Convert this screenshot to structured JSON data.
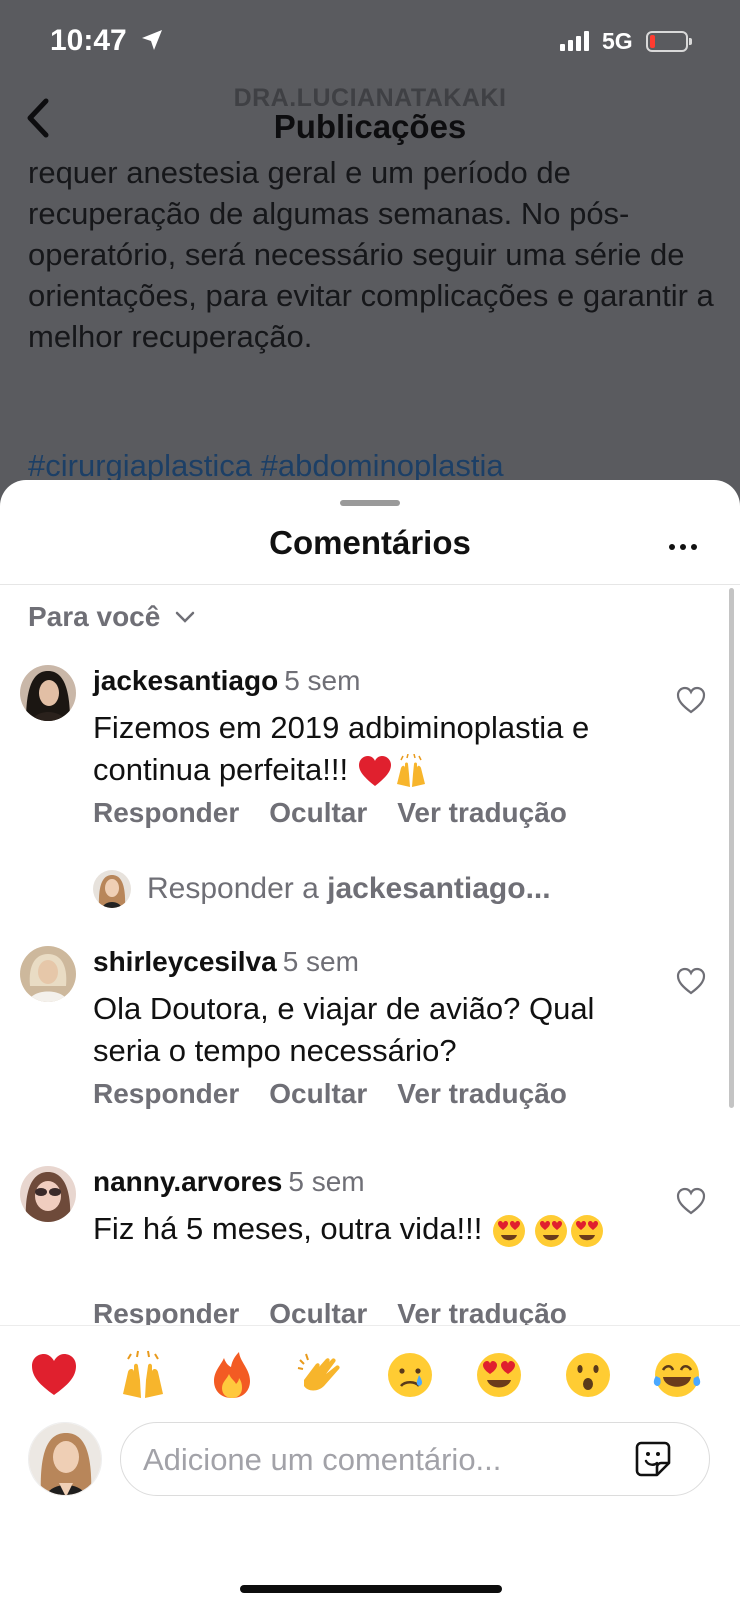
{
  "status_bar": {
    "time": "10:47",
    "network": "5G",
    "battery_level": 0.1
  },
  "background_post": {
    "username": "DRA.LUCIANATAKAKI",
    "page_title": "Publicações",
    "caption": "requer anestesia geral e um período de recuperação de algumas semanas. No pós-operatório, será necessário seguir uma série de orientações, para evitar complicações e garantir a melhor recuperação.",
    "hashtags": "#cirurgiaplastica #abdominoplastia"
  },
  "sheet": {
    "title": "Comentários",
    "more_icon": "more-horizontal-icon",
    "filter_label": "Para você"
  },
  "comments": [
    {
      "username": "jackesantiago",
      "time": "5 sem",
      "text": "Fizemos em 2019 adbiminoplastia e continua perfeita!!!",
      "emojis": [
        "red-heart",
        "raising-hands"
      ],
      "actions": [
        "Responder",
        "Ocultar",
        "Ver tradução"
      ]
    },
    {
      "username": "shirleycesilva",
      "time": "5 sem",
      "text": "Ola Doutora, e viajar de avião? Qual seria o tempo necessário?",
      "emojis": [],
      "actions": [
        "Responder",
        "Ocultar",
        "Ver tradução"
      ]
    },
    {
      "username": "nanny.arvores",
      "time": "5 sem",
      "text": "Fiz há 5 meses, outra vida!!!",
      "emojis": [
        "heart-eyes",
        "heart-eyes",
        "heart-eyes"
      ],
      "actions": [
        "Responder",
        "Ocultar",
        "Ver tradução"
      ]
    }
  ],
  "reply_prompt": {
    "prefix": "Responder a",
    "target": "jackesantiago..."
  },
  "quick_reactions": [
    "red-heart",
    "raising-hands",
    "fire",
    "clapping-hands",
    "crying-face",
    "heart-eyes",
    "surprised-face",
    "tears-of-joy"
  ],
  "composer": {
    "placeholder": "Adicione um comentário...",
    "sticker_icon": "sticker-icon"
  },
  "colors": {
    "sheet_bg": "#ffffff",
    "dim_overlay": "#5a5b5f",
    "muted_text": "#6f6f76",
    "like_red": "#e0202e"
  }
}
